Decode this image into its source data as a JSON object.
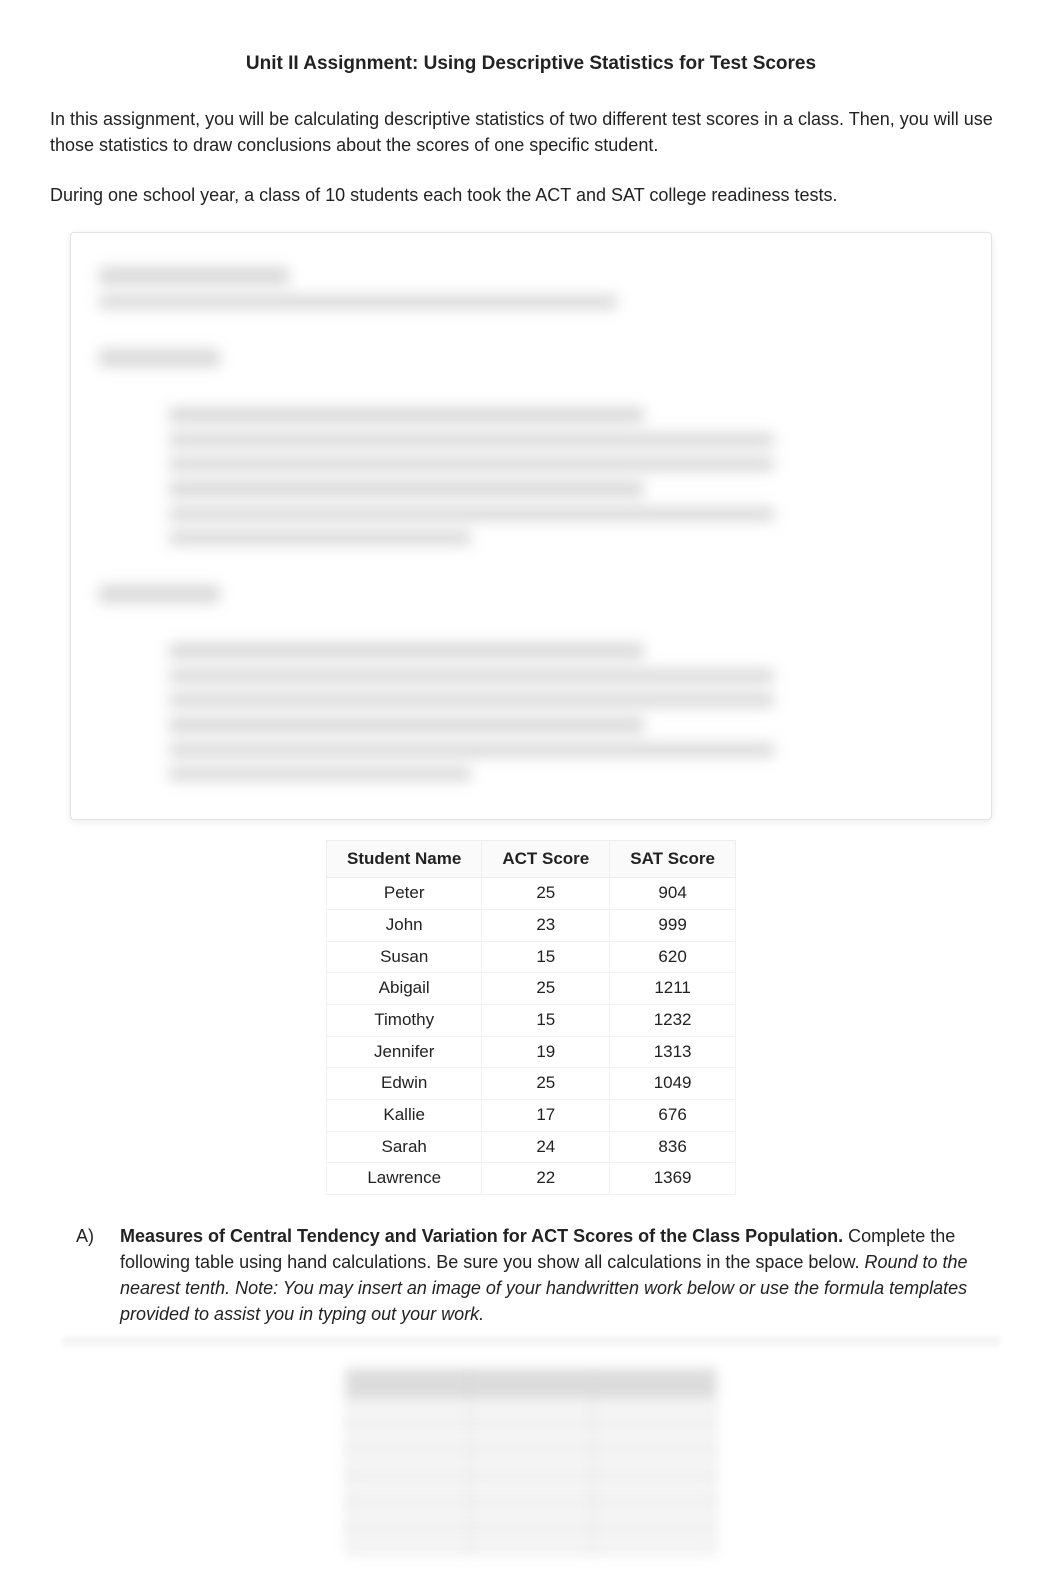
{
  "title": "Unit II Assignment: Using Descriptive Statistics for Test Scores",
  "intro1": "In this assignment, you will be calculating descriptive statistics of two different test scores in a class. Then, you will use those statistics to draw conclusions about the scores of one specific student.",
  "intro2": "During one school year, a class of 10 students each took the ACT and SAT college readiness tests.",
  "table": {
    "headers": [
      "Student Name",
      "ACT Score",
      "SAT Score"
    ],
    "rows": [
      {
        "name": "Peter",
        "act": "25",
        "sat": "904"
      },
      {
        "name": "John",
        "act": "23",
        "sat": "999"
      },
      {
        "name": "Susan",
        "act": "15",
        "sat": "620"
      },
      {
        "name": "Abigail",
        "act": "25",
        "sat": "1211"
      },
      {
        "name": "Timothy",
        "act": "15",
        "sat": "1232"
      },
      {
        "name": "Jennifer",
        "act": "19",
        "sat": "1313"
      },
      {
        "name": "Edwin",
        "act": "25",
        "sat": "1049"
      },
      {
        "name": "Kallie",
        "act": "17",
        "sat": "676"
      },
      {
        "name": "Sarah",
        "act": "24",
        "sat": "836"
      },
      {
        "name": "Lawrence",
        "act": "22",
        "sat": "1369"
      }
    ]
  },
  "question": {
    "letter": "A)",
    "bold": "Measures of Central Tendency and Variation for ACT Scores of the Class Population.",
    "tail": " Complete the following table using hand calculations. Be sure you show all calculations in the space below. ",
    "italic": "Round to the nearest tenth. Note: You may insert an image of your handwritten work below or use the formula templates provided to assist you in typing out your work."
  }
}
